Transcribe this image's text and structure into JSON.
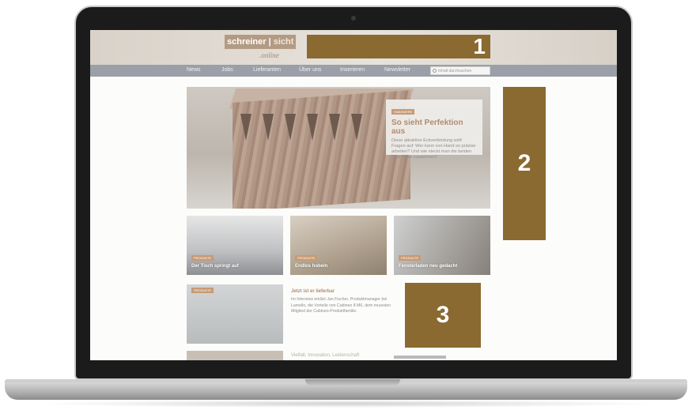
{
  "site": {
    "logo_main": "schreiner",
    "logo_sub": "sicht",
    "logo_online": "online"
  },
  "nav": [
    {
      "label": "News"
    },
    {
      "label": "Jobs"
    },
    {
      "label": "Lieferanten"
    },
    {
      "label": "Über uns"
    },
    {
      "label": "Inserieren"
    },
    {
      "label": "Newsletter"
    }
  ],
  "search": {
    "placeholder": "Inhalt durchsuchen"
  },
  "hero": {
    "tag": "HANDWERK",
    "title": "So sieht Perfektion aus",
    "text": "Diese attraktive Eckverbindung wirft Fragen auf: Wer kann von Hand so präzise arbeiten? Und wie steckt man die beiden Teile bloss zusammen?"
  },
  "tiles": [
    {
      "tag": "PRODUKTE",
      "label": "Der Tisch springt auf"
    },
    {
      "tag": "PRODUKTE",
      "label": "Endlos hobeln"
    },
    {
      "tag": "PRODUKTE",
      "label": "Fensterladen neu gedacht"
    }
  ],
  "article": {
    "tag": "PRODUKTE",
    "title": "Jetzt ist er lieferbar",
    "text": "Im Interview erklärt Jan Fischer, Produktmanager bei Lamello, die Vorteile von Cabineo 8 M6, dem neuesten Mitglied der Cabineo-Produktfamilie."
  },
  "article2": {
    "title": "Vielfalt, Innovation, Leidenschaft"
  },
  "overlays": [
    {
      "label": "1"
    },
    {
      "label": "2"
    },
    {
      "label": "3"
    }
  ],
  "colors": {
    "overlay": "#8a6a30",
    "accent": "#b08c6e",
    "nav_bg": "#9a9fa8"
  }
}
